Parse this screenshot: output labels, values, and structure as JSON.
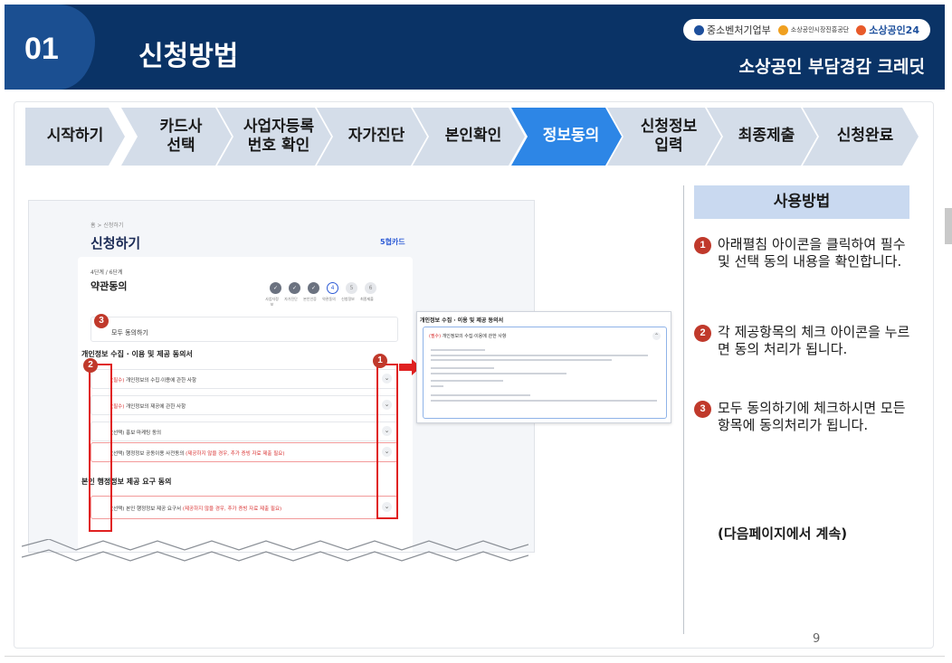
{
  "header": {
    "number": "01",
    "title": "신청방법",
    "subtitle": "소상공인 부담경감 크레딧",
    "logos": [
      {
        "label": "중소벤처기업부",
        "color": "#1d4f9c"
      },
      {
        "label": "소상공인시장진흥공단",
        "color": "#f0a020"
      },
      {
        "label": "소상공인24",
        "color": "#e85a2a"
      }
    ]
  },
  "steps": [
    {
      "label": "시작하기",
      "active": false
    },
    {
      "label": "카드사\n선택",
      "active": false
    },
    {
      "label": "사업자등록\n번호 확인",
      "active": false
    },
    {
      "label": "자가진단",
      "active": false
    },
    {
      "label": "본인확인",
      "active": false
    },
    {
      "label": "정보동의",
      "active": true
    },
    {
      "label": "신청정보\n입력",
      "active": false
    },
    {
      "label": "최종제출",
      "active": false
    },
    {
      "label": "신청완료",
      "active": false
    }
  ],
  "mock": {
    "breadcrumb": "홈 > 신청하기",
    "title": "신청하기",
    "card_brand": "5협카드",
    "stage": "4단계 / 6단계",
    "card_title": "약관동의",
    "progress_labels": [
      "사업자정보",
      "자가진단",
      "본인인증",
      "약관동의",
      "신청정보",
      "최종제출"
    ],
    "progress_current": 4,
    "all_agree": "모두 동의하기",
    "section1": "개인정보 수집 · 이용 및 제공 동의서",
    "rows": [
      {
        "tag": "(필수)",
        "text": "개인정보의 수집·이용에 관한 사항",
        "warn": ""
      },
      {
        "tag": "(필수)",
        "text": "개인정보의 제공에 관한 사항",
        "warn": ""
      },
      {
        "tag": "(선택)",
        "text": "홍보 마케팅 동의",
        "warn": ""
      },
      {
        "tag": "(선택)",
        "text": "행정정보 공동이용 사전동의",
        "warn": "(제공하지 않을 경우, 추가 증빙 자료 제출 필요)"
      }
    ],
    "section2": "본인 행정정보 제공 요구 동의",
    "row_last": {
      "tag": "(선택)",
      "text": "본인 행정정보 제공 요구서",
      "warn": "(제공하지 않을 경우, 추가 증빙 자료 제출 필요)"
    }
  },
  "popup": {
    "title": "개인정보 수집 · 이용 및 제공 동의서",
    "head_tag": "(필수)",
    "head_text": "개인정보의 수집·이용에 관한 사항"
  },
  "markers": {
    "m1": "1",
    "m2": "2",
    "m3": "3"
  },
  "usage": {
    "title": "사용방법",
    "items": [
      {
        "num": "1",
        "text": "아래펼침 아이콘을 클릭하여 필수 및 선택 동의 내용을 확인합니다."
      },
      {
        "num": "2",
        "text": "각 제공항목의  체크 아이콘을 누르면 동의 처리가 됩니다."
      },
      {
        "num": "3",
        "text": "모두 동의하기에 체크하시면 모든 항목에 동의처리가 됩니다."
      }
    ],
    "continue": "(다음페이지에서 계속)"
  },
  "page_number": "9"
}
